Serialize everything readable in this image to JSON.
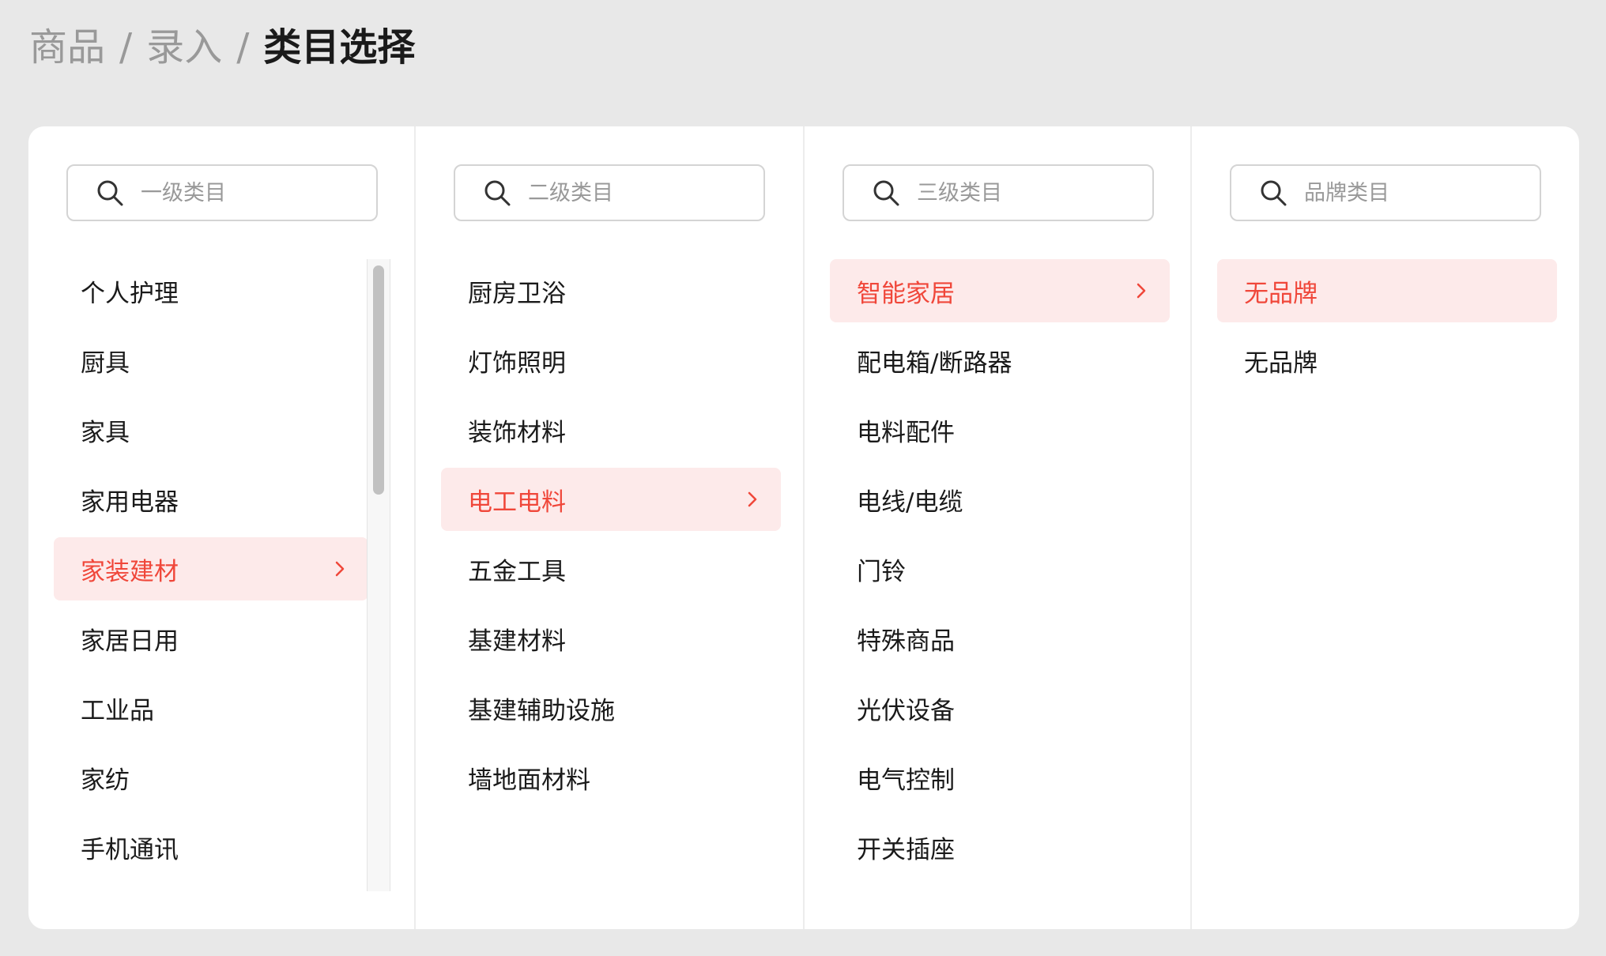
{
  "breadcrumb": {
    "items": [
      "商品",
      "录入"
    ],
    "separator": "/",
    "current": "类目选择"
  },
  "columns": [
    {
      "search_placeholder": "一级类目",
      "items": [
        "个人护理",
        "厨具",
        "家具",
        "家用电器",
        "家装建材",
        "家居日用",
        "工业品",
        "家纺",
        "手机通讯"
      ],
      "active_index": 4
    },
    {
      "search_placeholder": "二级类目",
      "items": [
        "厨房卫浴",
        "灯饰照明",
        "装饰材料",
        "电工电料",
        "五金工具",
        "基建材料",
        "基建辅助设施",
        "墙地面材料"
      ],
      "active_index": 3
    },
    {
      "search_placeholder": "三级类目",
      "items": [
        "智能家居",
        "配电箱/断路器",
        "电料配件",
        "电线/电缆",
        "门铃",
        "特殊商品",
        "光伏设备",
        "电气控制",
        "开关插座"
      ],
      "active_index": 0
    },
    {
      "search_placeholder": "品牌类目",
      "items": [
        "无品牌",
        "无品牌"
      ],
      "active_index": 0
    }
  ],
  "colors": {
    "accent": "#f0473a",
    "active_bg": "#fdeaea",
    "page_bg": "#e8e8e8"
  }
}
